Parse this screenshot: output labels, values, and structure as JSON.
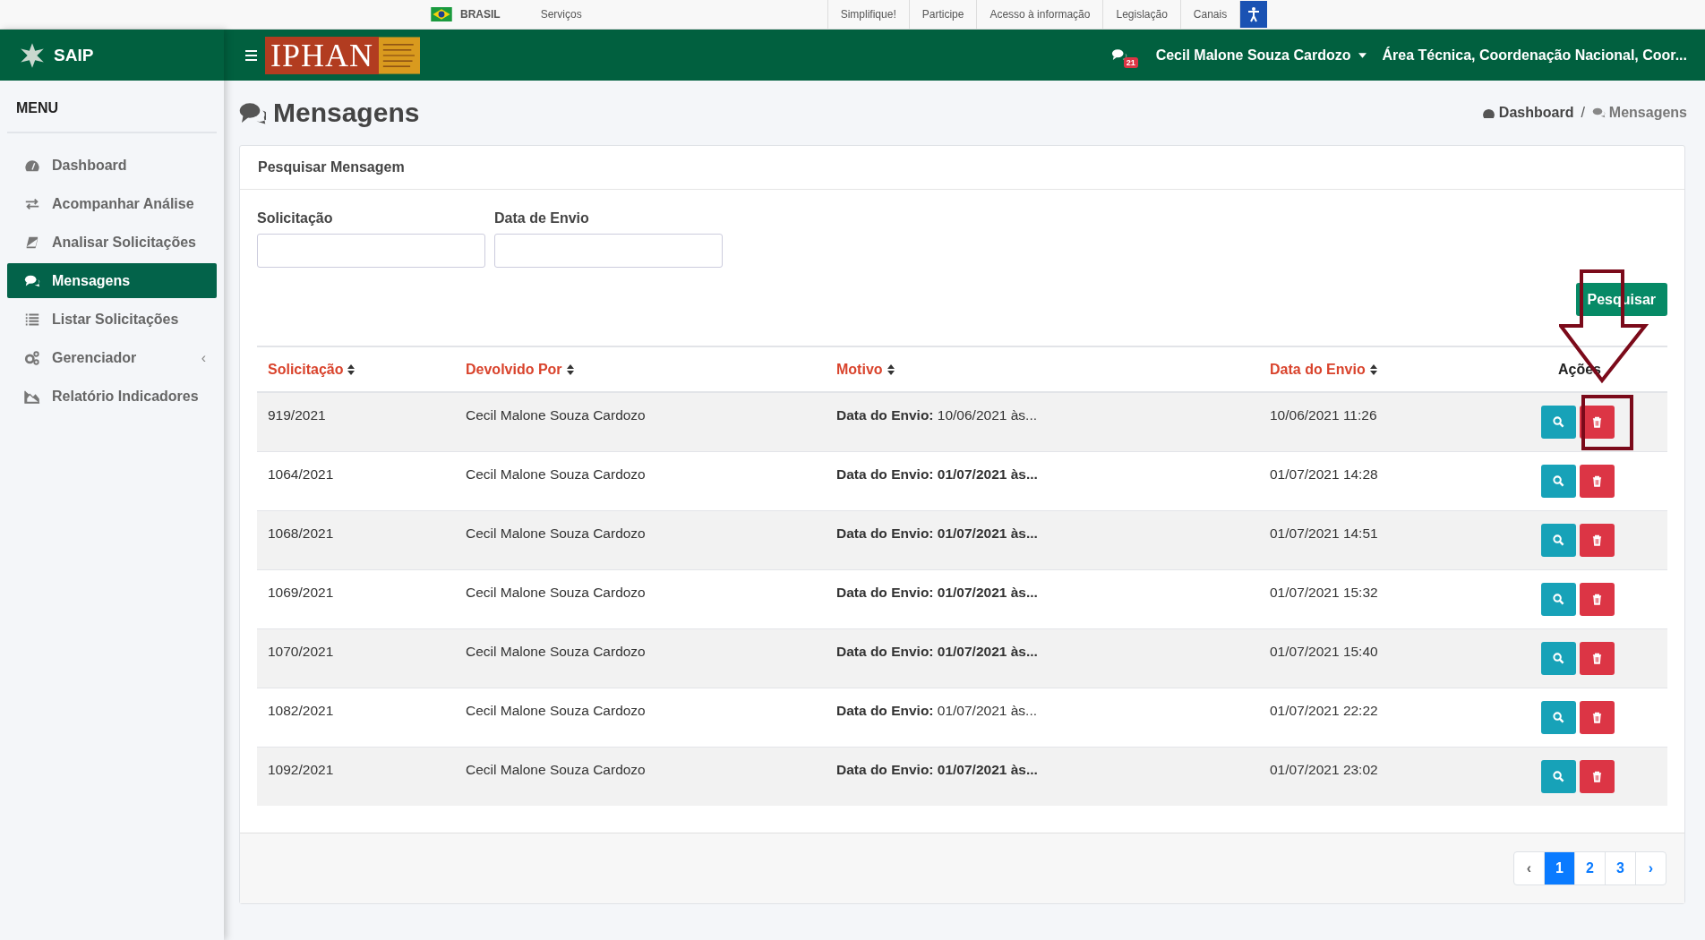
{
  "gov_bar": {
    "country": "BRASIL",
    "services": "Serviços",
    "links": [
      "Simplifique!",
      "Participe",
      "Acesso à informação",
      "Legislação",
      "Canais"
    ]
  },
  "header": {
    "app_name": "SAIP",
    "logo_text": "IPHAN",
    "message_count": "21",
    "user": "Cecil Malone Souza Cardozo",
    "department": "Área Técnica, Coordenação Nacional, Coor..."
  },
  "sidebar": {
    "title": "MENU",
    "items": [
      {
        "label": "Dashboard",
        "kind": "dashboard",
        "selected": false
      },
      {
        "label": "Acompanhar Análise",
        "kind": "exchange",
        "selected": false
      },
      {
        "label": "Analisar Solicitações",
        "kind": "book",
        "selected": false
      },
      {
        "label": "Mensagens",
        "kind": "comments",
        "selected": true
      },
      {
        "label": "Listar Solicitações",
        "kind": "list",
        "selected": false
      },
      {
        "label": "Gerenciador",
        "kind": "cogs",
        "selected": false,
        "submenu": "‹"
      },
      {
        "label": "Relatório Indicadores",
        "kind": "chart",
        "selected": false
      }
    ]
  },
  "page": {
    "title": "Mensagens",
    "breadcrumb": [
      "Dashboard",
      "Mensagens"
    ],
    "breadcrumb_separator": "/"
  },
  "search": {
    "title": "Pesquisar Mensagem",
    "fields": [
      {
        "label": "Solicitação"
      },
      {
        "label": "Data de Envio"
      }
    ],
    "button": "Pesquisar"
  },
  "table": {
    "columns": [
      {
        "label": "Solicitação",
        "sortable": true
      },
      {
        "label": "Devolvido Por",
        "sortable": true
      },
      {
        "label": "Motivo",
        "sortable": true
      },
      {
        "label": "Data do Envio",
        "sortable": true
      },
      {
        "label": "Ações",
        "sortable": false
      }
    ],
    "rows": [
      {
        "id": "919/2021",
        "by": "Cecil Malone Souza Cardozo",
        "reason": "**Data do Envio:** 10/06/2021 às...",
        "bold": false,
        "date": "10/06/2021 11:26"
      },
      {
        "id": "1064/2021",
        "by": "Cecil Malone Souza Cardozo",
        "reason": "Data do Envio: 01/07/2021 às...",
        "bold": true,
        "date": "01/07/2021 14:28"
      },
      {
        "id": "1068/2021",
        "by": "Cecil Malone Souza Cardozo",
        "reason": "Data do Envio: 01/07/2021 às...",
        "bold": true,
        "date": "01/07/2021 14:51"
      },
      {
        "id": "1069/2021",
        "by": "Cecil Malone Souza Cardozo",
        "reason": "Data do Envio: 01/07/2021 às...",
        "bold": true,
        "date": "01/07/2021 15:32"
      },
      {
        "id": "1070/2021",
        "by": "Cecil Malone Souza Cardozo",
        "reason": "Data do Envio: 01/07/2021 às...",
        "bold": true,
        "date": "01/07/2021 15:40"
      },
      {
        "id": "1082/2021",
        "by": "Cecil Malone Souza Cardozo",
        "reason": "**Data do Envio:** 01/07/2021 às...",
        "bold": false,
        "date": "01/07/2021 22:22"
      },
      {
        "id": "1092/2021",
        "by": "Cecil Malone Souza Cardozo",
        "reason": "Data do Envio: 01/07/2021 às...",
        "bold": true,
        "date": "01/07/2021 23:02"
      }
    ]
  },
  "pagination": {
    "prev": "‹",
    "next": "›",
    "pages": [
      {
        "label": "1",
        "selected": true
      },
      {
        "label": "2",
        "selected": false
      },
      {
        "label": "3",
        "selected": false
      }
    ]
  }
}
